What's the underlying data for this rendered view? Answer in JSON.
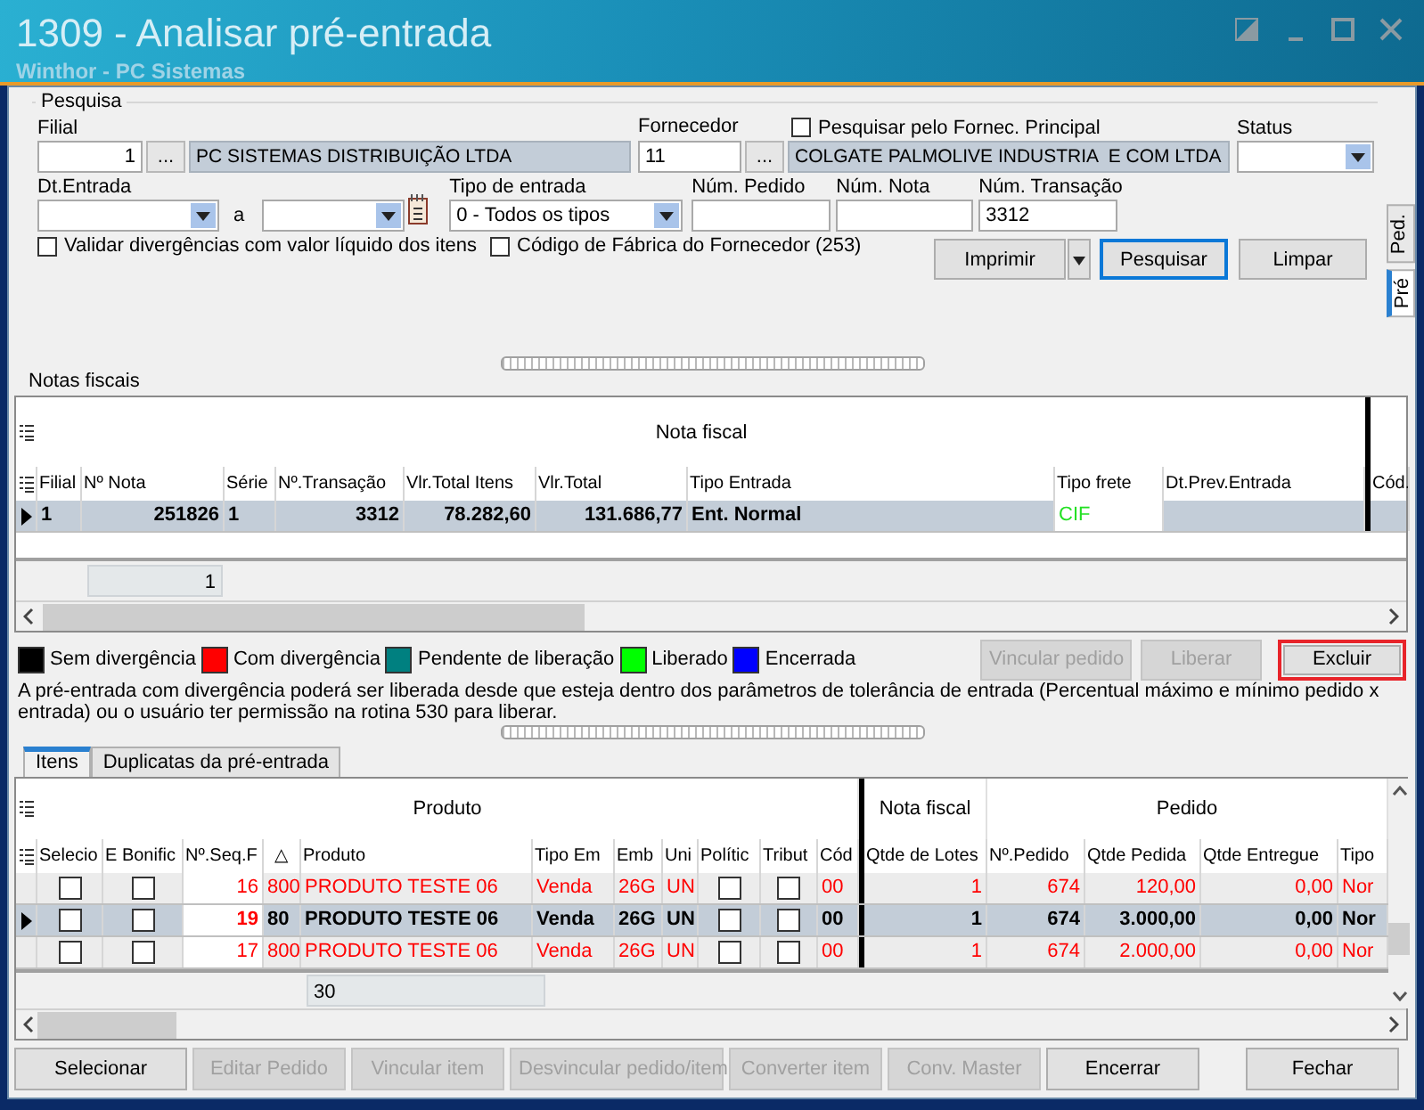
{
  "window": {
    "title": "1309 - Analisar pré-entrada",
    "subtitle": "Winthor - PC Sistemas"
  },
  "search": {
    "title": "Pesquisa",
    "filial": {
      "label": "Filial",
      "value": "1",
      "name": "PC SISTEMAS DISTRIBUIÇÃO LTDA",
      "button": "..."
    },
    "fornecedor": {
      "label": "Fornecedor",
      "value": "11",
      "name": "COLGATE PALMOLIVE INDUSTRIA  E COM LTDA",
      "button": "..."
    },
    "principal": {
      "label": "Pesquisar pelo Fornec. Principal",
      "checked": false
    },
    "status": {
      "label": "Status"
    },
    "dt_entrada": {
      "label": "Dt.Entrada",
      "separator": "a"
    },
    "tipo_entrada": {
      "label": "Tipo de entrada",
      "value": "0 - Todos os tipos"
    },
    "num_pedido": {
      "label": "Núm. Pedido"
    },
    "num_nota": {
      "label": "Núm. Nota"
    },
    "num_transacao": {
      "label": "Núm. Transação",
      "value": "3312"
    },
    "checkboxes": [
      {
        "label": "Validar divergências com valor líquido dos itens",
        "checked": false
      },
      {
        "label": "Código de Fábrica do Fornecedor (253)",
        "checked": false
      }
    ],
    "buttons": [
      {
        "label": "Imprimir",
        "kind": "split",
        "focused": false
      },
      {
        "label": "Pesquisar",
        "kind": "plain",
        "focused": true
      },
      {
        "label": "Limpar",
        "kind": "plain",
        "focused": false
      }
    ]
  },
  "side_tabs": [
    {
      "label": "Ped.",
      "selected": false
    },
    {
      "label": "Pré",
      "selected": true
    }
  ],
  "notas": {
    "title": "Notas fiscais",
    "band": "Nota fiscal",
    "columns": [
      "Filial",
      "Nº Nota",
      "Série",
      "Nº.Transação",
      "Vlr.Total Itens",
      "Vlr.Total",
      "Tipo Entrada",
      "Tipo frete",
      "Dt.Prev.Entrada",
      "Cód."
    ],
    "rows": [
      {
        "selected": true,
        "color": "#000000",
        "filial": "1",
        "nota": "251826",
        "serie": "1",
        "transacao": "3312",
        "vlr_itens": "78.282,60",
        "vlr_total": "131.686,77",
        "tipo_entrada": "Ent. Normal",
        "tipo_frete": "CIF"
      }
    ],
    "footer": "1"
  },
  "legend": [
    {
      "label": "Sem divergência",
      "color": "#000000"
    },
    {
      "label": "Com divergência",
      "color": "#ff0000"
    },
    {
      "label": "Pendente de liberação",
      "color": "#008080"
    },
    {
      "label": "Liberado",
      "color": "#00ff00"
    },
    {
      "label": "Encerrada",
      "color": "#0000ff"
    }
  ],
  "actions": [
    {
      "label": "Vincular pedido",
      "disabled": true,
      "highlighted": false
    },
    {
      "label": "Liberar",
      "disabled": true,
      "highlighted": false
    },
    {
      "label": "Excluir",
      "disabled": false,
      "highlighted": true
    }
  ],
  "note": "A pré-entrada com divergência poderá ser liberada desde que esteja dentro dos parâmetros de tolerância de entrada (Percentual máximo e mínimo pedido x entrada) ou o usuário ter permissão na rotina 530 para liberar.",
  "item_tabs": [
    {
      "label": "Itens",
      "selected": true
    },
    {
      "label": "Duplicatas da pré-entrada",
      "selected": false
    }
  ],
  "itens": {
    "bands": [
      "Produto",
      "Nota fiscal",
      "Pedido"
    ],
    "columns": [
      "Selecio",
      "E Bonific",
      "Nº.Seq.F",
      "△",
      "Produto",
      "Tipo Em",
      "Emb",
      "Uni",
      "Polític",
      "Tribut",
      "Cód",
      "Qtde de Lotes",
      "Nº.Pedido",
      "Qtde Pedida",
      "Qtde Entregue",
      "Tipo"
    ],
    "rows": [
      {
        "selected": false,
        "color": "#ff0000",
        "selecionar": {
          "checked": false
        },
        "bonific": {
          "checked": false
        },
        "seq": "16",
        "col_4": "800",
        "produto": "PRODUTO TESTE 06",
        "tipo_emb": "Venda",
        "emb": "26G",
        "uni": "UN",
        "politica": {
          "checked": false
        },
        "tributacao": {
          "checked": false
        },
        "cod": "00",
        "lotes": "1",
        "pedido": "674",
        "qtde_pedida": "120,00",
        "qtde_entregue": "0,00",
        "tipo": "Nor"
      },
      {
        "selected": true,
        "color": "#ff0000",
        "selecionar": {
          "checked": false
        },
        "bonific": {
          "checked": false
        },
        "seq": "19",
        "col_4": "80",
        "produto": "PRODUTO TESTE 06",
        "tipo_emb": "Venda",
        "emb": "26G",
        "uni": "UN",
        "politica": {
          "checked": false
        },
        "tributacao": {
          "checked": false
        },
        "cod": "00",
        "lotes": "1",
        "pedido": "674",
        "qtde_pedida": "3.000,00",
        "qtde_entregue": "0,00",
        "tipo": "Nor"
      },
      {
        "selected": false,
        "color": "#ff0000",
        "selecionar": {
          "checked": false
        },
        "bonific": {
          "checked": false
        },
        "seq": "17",
        "col_4": "800",
        "produto": "PRODUTO TESTE 06",
        "tipo_emb": "Venda",
        "emb": "26G",
        "uni": "UN",
        "politica": {
          "checked": false
        },
        "tributacao": {
          "checked": false
        },
        "cod": "00",
        "lotes": "1",
        "pedido": "674",
        "qtde_pedida": "2.000,00",
        "qtde_entregue": "0,00",
        "tipo": "Nor"
      }
    ],
    "footer": "30"
  },
  "bottom_buttons": [
    {
      "label": "Selecionar",
      "disabled": false
    },
    {
      "label": "Editar Pedido",
      "disabled": true
    },
    {
      "label": "Vincular item",
      "disabled": true
    },
    {
      "label": "Desvincular pedido/item",
      "disabled": true
    },
    {
      "label": "Converter item",
      "disabled": true
    },
    {
      "label": "Conv. Master",
      "disabled": true
    },
    {
      "label": "Encerrar",
      "disabled": false
    },
    {
      "label": "Fechar",
      "disabled": false
    }
  ]
}
